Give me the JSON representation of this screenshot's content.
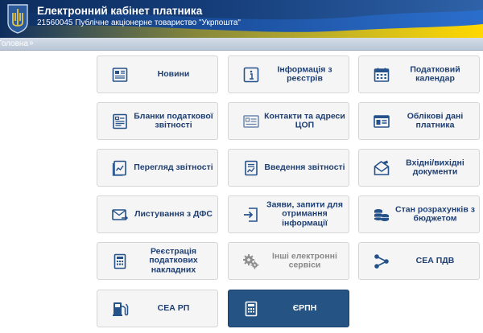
{
  "header": {
    "title": "Електронний кабінет платника",
    "subtitle": "21560045 Публічне акціонерне товариство \"Укрпошта\"",
    "brand_color": "#153e7a",
    "flag_colors": [
      "#1f5cb8",
      "#f5d000"
    ]
  },
  "breadcrumb": {
    "home": "Головна",
    "separator": "»"
  },
  "tiles": [
    {
      "label": "Новини",
      "icon": "news-icon"
    },
    {
      "label": "Інформація з реєстрів",
      "icon": "info-icon"
    },
    {
      "label": "Податковий календар",
      "icon": "calendar-icon"
    },
    {
      "label": "Бланки податкової звітності",
      "icon": "forms-icon"
    },
    {
      "label": "Контакти та адреси ЦОП",
      "icon": "contact-card-icon"
    },
    {
      "label": "Облікові дані платника",
      "icon": "account-data-icon"
    },
    {
      "label": "Перегляд звітності",
      "icon": "report-view-icon"
    },
    {
      "label": "Введення звітності",
      "icon": "report-input-icon"
    },
    {
      "label": "Вхідні/вихідні документи",
      "icon": "documents-icon"
    },
    {
      "label": "Листування з ДФС",
      "icon": "mail-icon"
    },
    {
      "label": "Заяви, запити для отримання інформації",
      "icon": "request-icon"
    },
    {
      "label": "Стан розрахунків з бюджетом",
      "icon": "coins-icon"
    },
    {
      "label": "Реєстрація податкових накладних",
      "icon": "invoice-registration-icon"
    },
    {
      "label": "Інші електронні сервіси",
      "icon": "gears-icon",
      "state": "disabled"
    },
    {
      "label": "СЕА ПДВ",
      "icon": "share-icon"
    },
    {
      "label": "СЕА РП",
      "icon": "fuel-pump-icon"
    },
    {
      "label": "ЄРПН",
      "icon": "invoice-registry-icon",
      "state": "active"
    }
  ],
  "colors": {
    "tile_text": "#1e3f73",
    "tile_background": "#f5f5f5",
    "active_tile": "#255383",
    "disabled_text": "#8a8a8a",
    "icon": "#25528a"
  }
}
